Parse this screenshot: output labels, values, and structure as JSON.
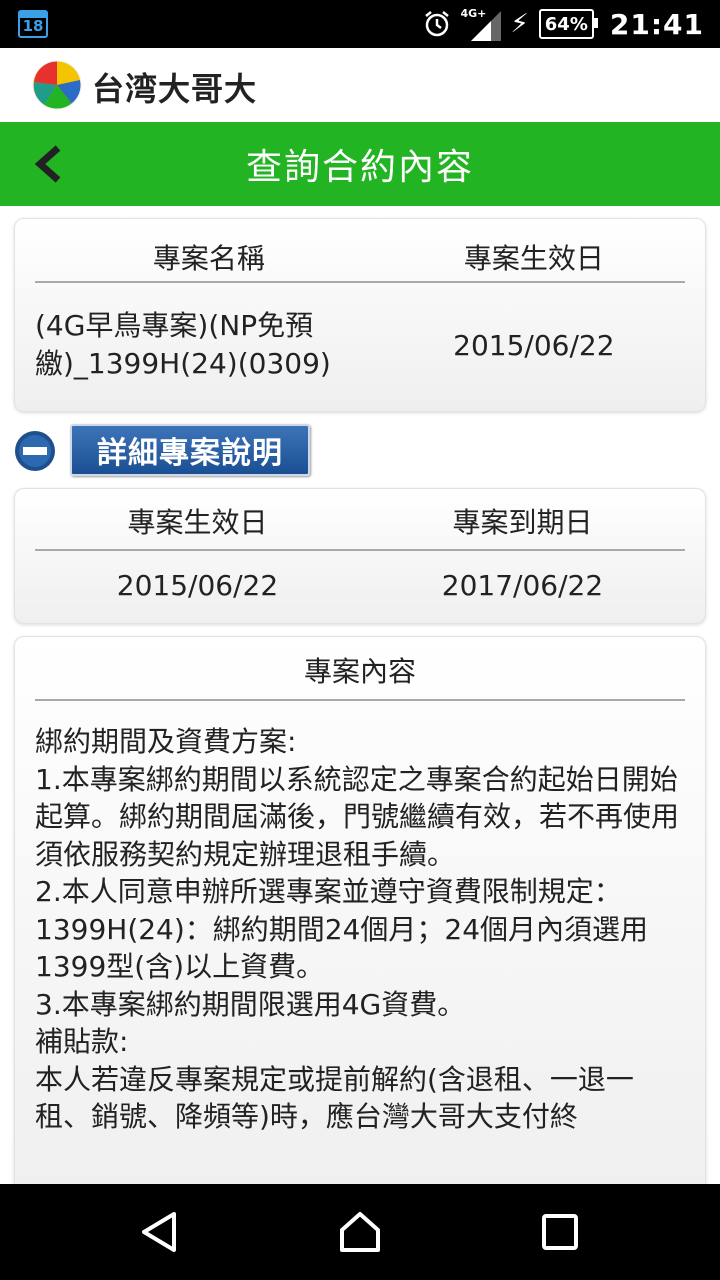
{
  "status_bar": {
    "calendar_day": "18",
    "network": "4G+",
    "battery": "64%",
    "time": "21:41",
    "icons": [
      "calendar-icon",
      "alarm-icon",
      "signal-icon",
      "charging-icon",
      "battery-icon"
    ]
  },
  "brand": {
    "name": "台湾大哥大",
    "logo_colors": [
      "#f7a600",
      "#e6312e",
      "#2b6cc4",
      "#22b423"
    ]
  },
  "header": {
    "title": "查詢合約內容",
    "back_icon": "chevron-left-icon",
    "color": "#22b423"
  },
  "plan_card": {
    "col1_header": "專案名稱",
    "col2_header": "專案生效日",
    "plan_name": "(4G早鳥專案)(NP免預繳)_1399H(24)(0309)",
    "effective_date": "2015/06/22"
  },
  "detail_toggle": {
    "icon": "collapse-icon",
    "label": "詳細專案說明"
  },
  "dates_card": {
    "col1_header": "專案生效日",
    "col2_header": "專案到期日",
    "start_date": "2015/06/22",
    "end_date": "2017/06/22"
  },
  "content_card": {
    "header": "專案內容",
    "text": "綁約期間及資費方案:\n1.本專案綁約期間以系統認定之專案合約起始日開始起算。綁約期間屆滿後，門號繼續有效，若不再使用須依服務契約規定辦理退租手續。\n2.本人同意申辦所選專案並遵守資費限制規定：1399H(24)：綁約期間24個月；24個月內須選用1399型(含)以上資費。\n3.本專案綁約期間限選用4G資費。\n補貼款:\n本人若違反專案規定或提前解約(含退租、一退一租、銷號、降頻等)時，應台灣大哥大支付終"
  },
  "nav_bar": {
    "icons": [
      "back-triangle-icon",
      "home-icon",
      "recents-icon"
    ]
  }
}
